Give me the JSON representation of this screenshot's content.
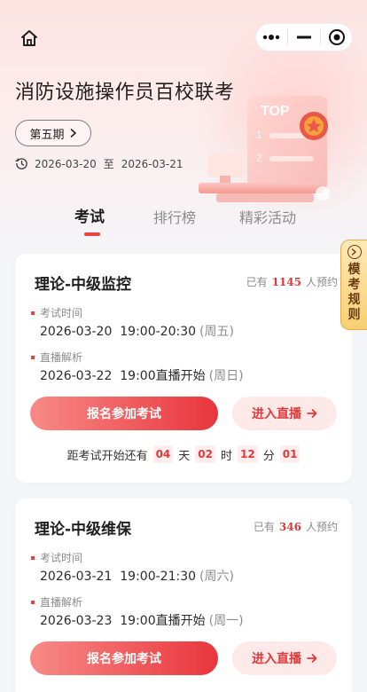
{
  "header": {
    "title": "消防设施操作员百校联考",
    "period_label": "第五期",
    "date_start": "2026-03-20",
    "date_sep": "至",
    "date_end": "2026-03-21",
    "illustration_text": "TOP"
  },
  "tabs": [
    {
      "label": "考试",
      "active": true
    },
    {
      "label": "排行榜",
      "active": false
    },
    {
      "label": "精彩活动",
      "active": false
    }
  ],
  "rules_tab": {
    "label": "模考规则"
  },
  "cards": [
    {
      "title": "理论-中级监控",
      "reserve_prefix": "已有",
      "reserve_count": "1145",
      "reserve_suffix": "人预约",
      "exam_label": "考试时间",
      "exam_time": "2026-03-20  19:00-20:30",
      "exam_week": "(周五)",
      "live_label": "直播解析",
      "live_time": "2026-03-22  19:00直播开始",
      "live_week": "(周日)",
      "signup_label": "报名参加考试",
      "live_btn_label": "进入直播",
      "countdown": {
        "prefix": "距考试开始还有",
        "days": "04",
        "days_unit": "天",
        "hours": "02",
        "hours_unit": "时",
        "minutes": "12",
        "minutes_unit": "分",
        "seconds": "01"
      }
    },
    {
      "title": "理论-中级维保",
      "reserve_prefix": "已有",
      "reserve_count": "346",
      "reserve_suffix": "人预约",
      "exam_label": "考试时间",
      "exam_time": "2026-03-21  19:00-21:30",
      "exam_week": "(周六)",
      "live_label": "直播解析",
      "live_time": "2026-03-23  19:00直播开始",
      "live_week": "(周一)",
      "signup_label": "报名参加考试",
      "live_btn_label": "进入直播"
    }
  ],
  "colors": {
    "accent": "#e8413e",
    "accent_light": "#fdeae8",
    "rules_bg": "#f8cf72"
  }
}
